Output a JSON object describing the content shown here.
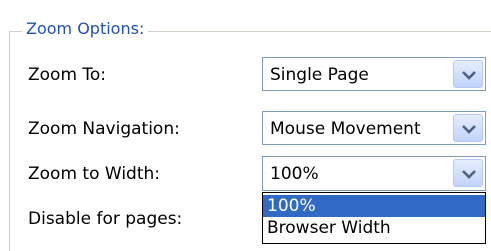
{
  "group": {
    "title": "Zoom Options:"
  },
  "rows": [
    {
      "label": "Zoom To:",
      "value": "Single Page"
    },
    {
      "label": "Zoom Navigation:",
      "value": "Mouse Movement"
    },
    {
      "label": "Zoom to Width:",
      "value": "100%"
    },
    {
      "label": "Disable for pages:"
    }
  ],
  "dropdown": {
    "options": [
      "100%",
      "Browser Width"
    ],
    "selected": "100%"
  },
  "icons": {
    "combo_button": "chevron-down-icon"
  },
  "colors": {
    "group_title": "#2152b4",
    "combo_border": "#7f9db9",
    "selection": "#316ac5",
    "chevron": "#4d6185"
  }
}
